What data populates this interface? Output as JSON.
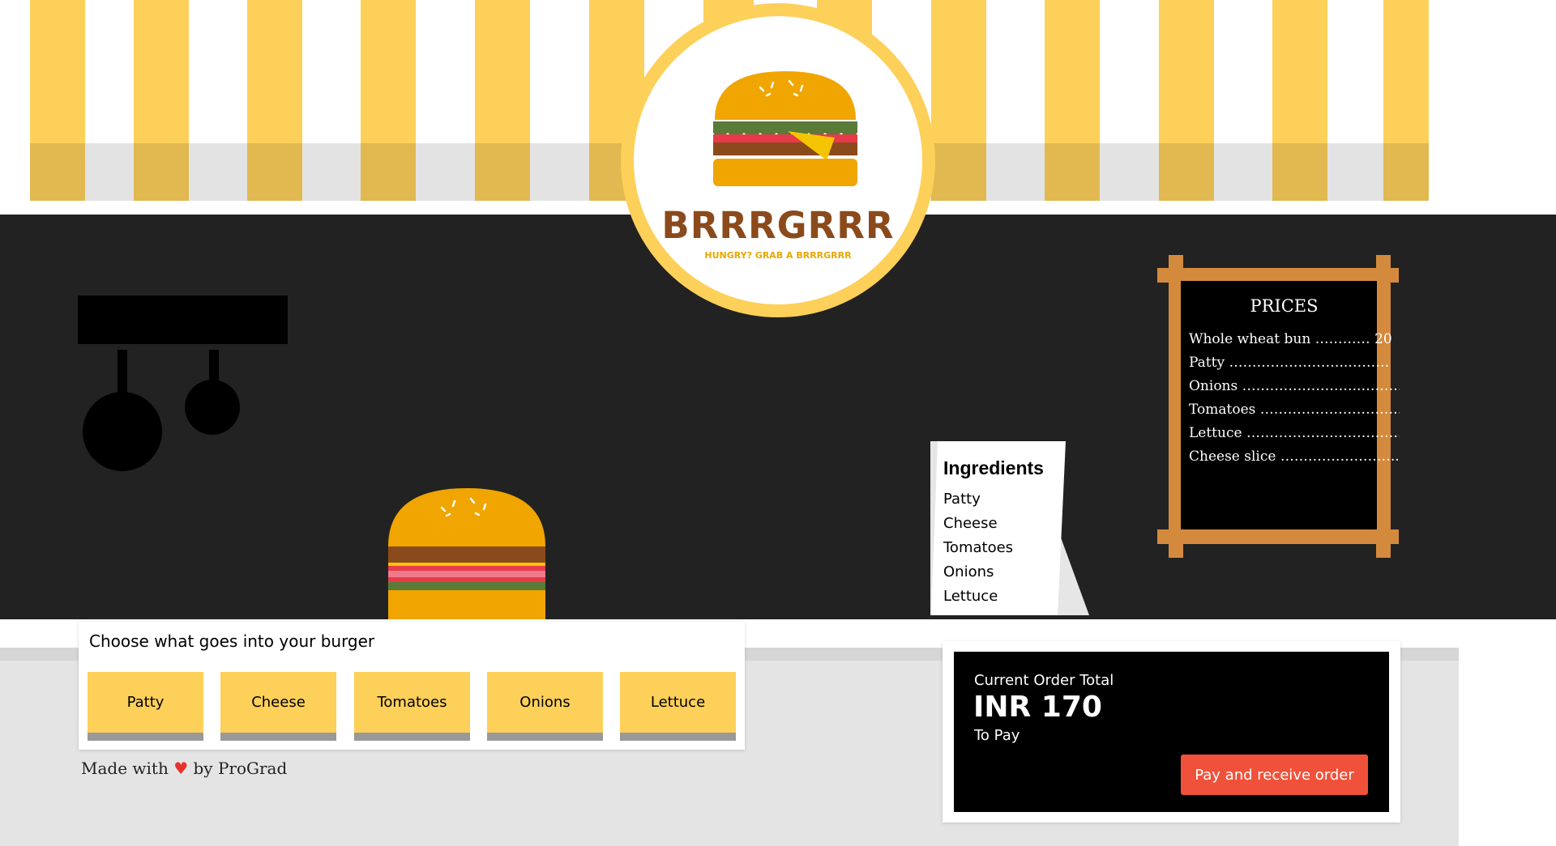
{
  "brand": {
    "name": "BRRRGRRR",
    "tagline": "HUNGRY? GRAB A BRRRGRRR"
  },
  "prices_board": {
    "title": "PRICES",
    "lines": [
      "Whole wheat bun ………… 20",
      "Patty ……………………..………",
      "Onions ……………………..………",
      "Tomatoes ……………………………",
      "Lettuce ………………………………",
      "Cheese slice …………………….."
    ]
  },
  "ingredients_card": {
    "title": "Ingredients",
    "items": [
      "Patty",
      "Cheese",
      "Tomatoes",
      "Onions",
      "Lettuce"
    ]
  },
  "chooser": {
    "title": "Choose what goes into your burger",
    "buttons": [
      "Patty",
      "Cheese",
      "Tomatoes",
      "Onions",
      "Lettuce"
    ]
  },
  "footer": {
    "prefix": "Made with",
    "suffix": "by ProGrad"
  },
  "order": {
    "label": "Current Order Total",
    "total": "INR 170",
    "to_pay": "To Pay",
    "pay_button": "Pay and receive order"
  },
  "colors": {
    "awning_yellow": "#fdd05a",
    "wall": "#222222",
    "brand_brown": "#8b4a1c",
    "pay_button": "#f0513a"
  }
}
